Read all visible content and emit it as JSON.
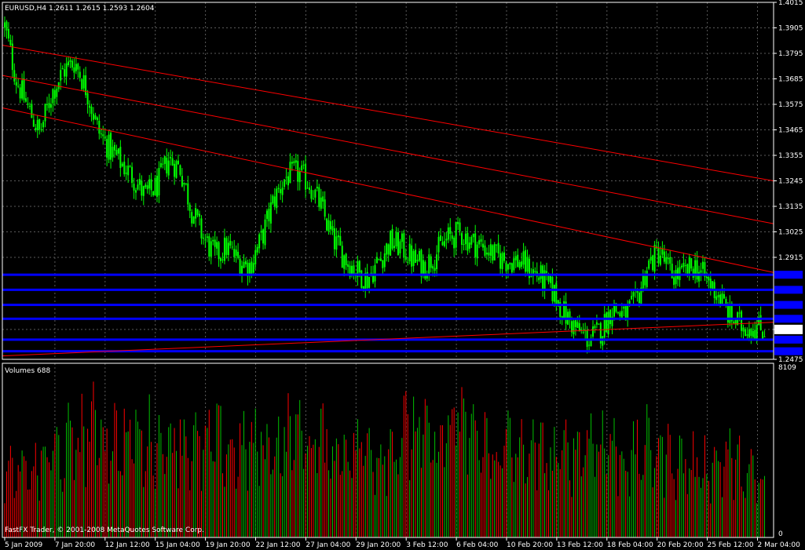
{
  "symbol_info": "EURUSD,H4  1.2611 1.2615 1.2593 1.2604",
  "volume_label": "Volumes 688",
  "copyright": "FastFX Trader, © 2001-2008 MetaQuotes Software Corp.",
  "colors": {
    "background": "#000000",
    "grid": "#5a5a5a",
    "candle": "#00ff00",
    "volume_up": "#00c000",
    "volume_down": "#ff0000",
    "trendline": "#ff0000",
    "level_line": "#0000ff",
    "axis": "#ffffff"
  },
  "chart_data": [
    {
      "type": "candlestick",
      "symbol": "EURUSD",
      "timeframe": "H4",
      "ylim": [
        1.2475,
        1.4015
      ],
      "y_ticks": [
        "1.4015",
        "1.3905",
        "1.3795",
        "1.3685",
        "1.3575",
        "1.3465",
        "1.3355",
        "1.3245",
        "1.3135",
        "1.3025",
        "1.2915",
        "1.2604",
        "1.2475"
      ],
      "current_price": "1.2604",
      "x_ticks": [
        "5 Jan 2009",
        "7 Jan 20:00",
        "12 Jan 12:00",
        "15 Jan 04:00",
        "19 Jan 20:00",
        "22 Jan 12:00",
        "27 Jan 04:00",
        "29 Jan 20:00",
        "3 Feb 12:00",
        "6 Feb 04:00",
        "10 Feb 20:00",
        "13 Feb 12:00",
        "18 Feb 04:00",
        "20 Feb 20:00",
        "25 Feb 12:00",
        "2 Mar 04:00"
      ],
      "close_path": [
        1.391,
        1.368,
        1.356,
        1.345,
        1.362,
        1.372,
        1.376,
        1.364,
        1.346,
        1.338,
        1.332,
        1.326,
        1.318,
        1.322,
        1.334,
        1.33,
        1.312,
        1.3,
        1.292,
        1.296,
        1.29,
        1.288,
        1.3,
        1.316,
        1.326,
        1.328,
        1.324,
        1.314,
        1.3,
        1.292,
        1.286,
        1.282,
        1.29,
        1.298,
        1.296,
        1.29,
        1.288,
        1.294,
        1.3,
        1.302,
        1.298,
        1.296,
        1.292,
        1.29,
        1.29,
        1.286,
        1.282,
        1.276,
        1.266,
        1.26,
        1.256,
        1.26,
        1.27,
        1.266,
        1.272,
        1.288,
        1.294,
        1.284,
        1.284,
        1.288,
        1.282,
        1.276,
        1.266,
        1.262,
        1.262,
        1.26
      ],
      "horizontal_levels": [
        1.284,
        1.2775,
        1.271,
        1.265,
        1.256,
        1.251
      ]
    },
    {
      "type": "bar",
      "name": "Volumes",
      "ylim": [
        0,
        8109
      ],
      "y_ticks": [
        "8109",
        "0"
      ],
      "volume_path": [
        3600,
        3300,
        3700,
        3900,
        4800,
        4500,
        5400,
        5800,
        6200,
        5500,
        5100,
        5700,
        5200,
        5300,
        5500,
        5800,
        4900,
        4800,
        5200,
        5000,
        4700,
        5100,
        5000,
        5200,
        5400,
        5900,
        5500,
        5200,
        4900,
        5000,
        5100,
        5000,
        4700,
        5100,
        5600,
        6100,
        5300,
        5200,
        6000,
        6400,
        6000,
        5100,
        4700,
        5000,
        4700,
        4800,
        4500,
        4400,
        4600,
        5000,
        5500,
        5600,
        5000,
        4300,
        4500,
        4800,
        4900,
        4400,
        4100,
        4000,
        3900,
        4200,
        4400,
        3600,
        3300,
        2600
      ]
    }
  ]
}
